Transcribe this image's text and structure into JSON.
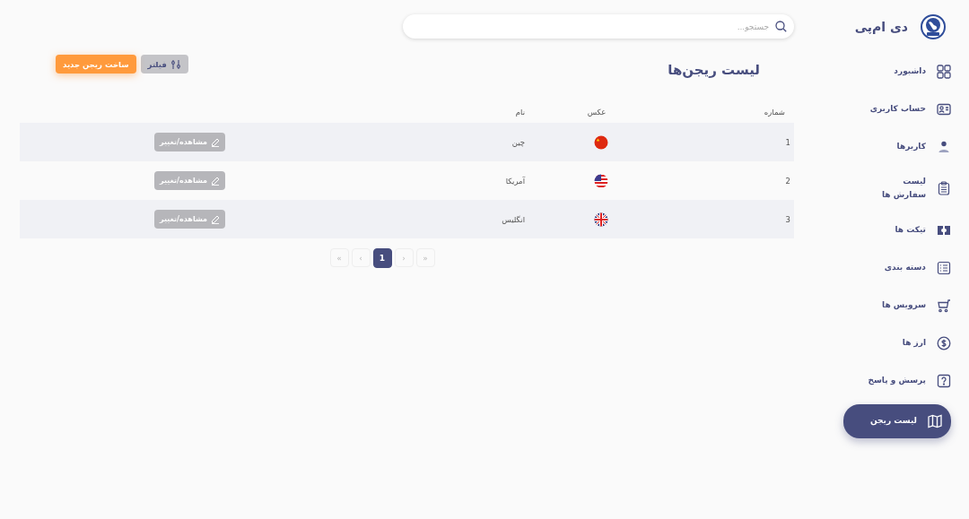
{
  "brand": {
    "name": "دی ام‌پی"
  },
  "sidebar": {
    "items": [
      {
        "label": "داشبورد",
        "selected": false
      },
      {
        "label": "حساب کاربری",
        "selected": false
      },
      {
        "label": "کاربرها",
        "selected": false
      },
      {
        "label": "لیست سفارش ها",
        "selected": false
      },
      {
        "label": "تیکت ها",
        "selected": false
      },
      {
        "label": "دسته بندی",
        "selected": false
      },
      {
        "label": "سرویس ها",
        "selected": false
      },
      {
        "label": "ارز ها",
        "selected": false
      },
      {
        "label": "پرسش و پاسخ",
        "selected": false
      },
      {
        "label": "لیست ریجن",
        "selected": true
      }
    ]
  },
  "search": {
    "placeholder": "جستجو..."
  },
  "page": {
    "title": "لیست ریجن‌ها",
    "buttons": [
      {
        "label": "فیلتر",
        "kind": "filter"
      },
      {
        "label": "ساخت ریجن جدید",
        "kind": "primary"
      }
    ]
  },
  "table": {
    "columns": [
      "شماره",
      "عکس",
      "نام"
    ],
    "rows": [
      {
        "number": "1",
        "name": "چین",
        "action": "مشاهده/تغییر"
      },
      {
        "number": "2",
        "name": "آمریکا",
        "action": "مشاهده/تغییر"
      },
      {
        "number": "3",
        "name": "انگلیس",
        "action": "مشاهده/تغییر"
      }
    ]
  },
  "pagination": [
    {
      "label": "»",
      "kind": "nav",
      "selected": false
    },
    {
      "label": "›",
      "kind": "nav",
      "selected": false
    },
    {
      "label": "1",
      "kind": "page",
      "selected": true
    },
    {
      "label": "‹",
      "kind": "nav",
      "selected": false
    },
    {
      "label": "«",
      "kind": "nav",
      "selected": false
    }
  ]
}
